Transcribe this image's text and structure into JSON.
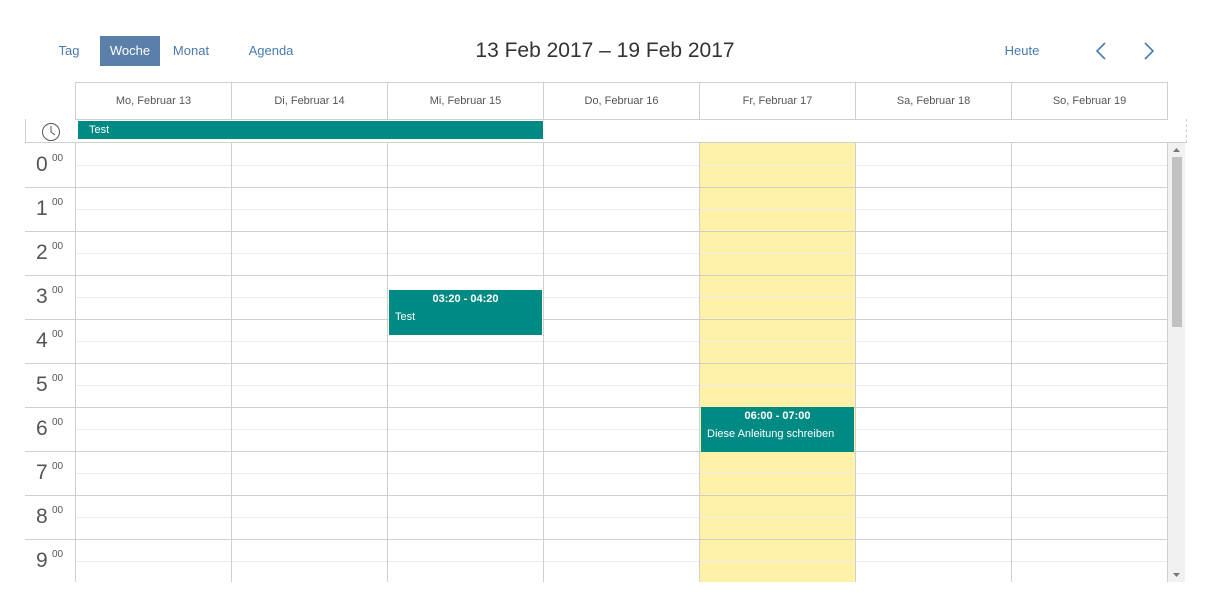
{
  "toolbar": {
    "views": [
      "Tag",
      "Woche",
      "Monat",
      "Agenda"
    ],
    "active_view": "Woche",
    "range_title": "13 Feb 2017 – 19 Feb 2017",
    "today_label": "Heute",
    "prev_icon": "chevron-left-icon",
    "next_icon": "chevron-right-icon"
  },
  "days": [
    "Mo, Februar 13",
    "Di, Februar 14",
    "Mi, Februar 15",
    "Do, Februar 16",
    "Fr, Februar 17",
    "Sa, Februar 18",
    "So, Februar 19"
  ],
  "highlighted_day": "Fr, Februar 17",
  "allday": {
    "icon": "clock-icon",
    "events": [
      {
        "title": "Test",
        "days": "Mo, Februar 13 – Mi, Februar 15"
      }
    ]
  },
  "hours": [
    "0",
    "1",
    "2",
    "3",
    "4",
    "5",
    "6",
    "7",
    "8",
    "9"
  ],
  "minutes_suffix": "00",
  "events": [
    {
      "day": "Mi, Februar 15",
      "time": "03:20 - 04:20",
      "title": "Test",
      "start": 3.333,
      "end": 4.333
    },
    {
      "day": "Fr, Februar 17",
      "time": "06:00 - 07:00",
      "title": "Diese Anleitung schreiben",
      "start": 6.0,
      "end": 7.0
    }
  ],
  "colors": {
    "event": "#008a84",
    "active_view": "#5a7fa9",
    "today_highlight": "#fff2a8",
    "link": "#4a7bad"
  }
}
